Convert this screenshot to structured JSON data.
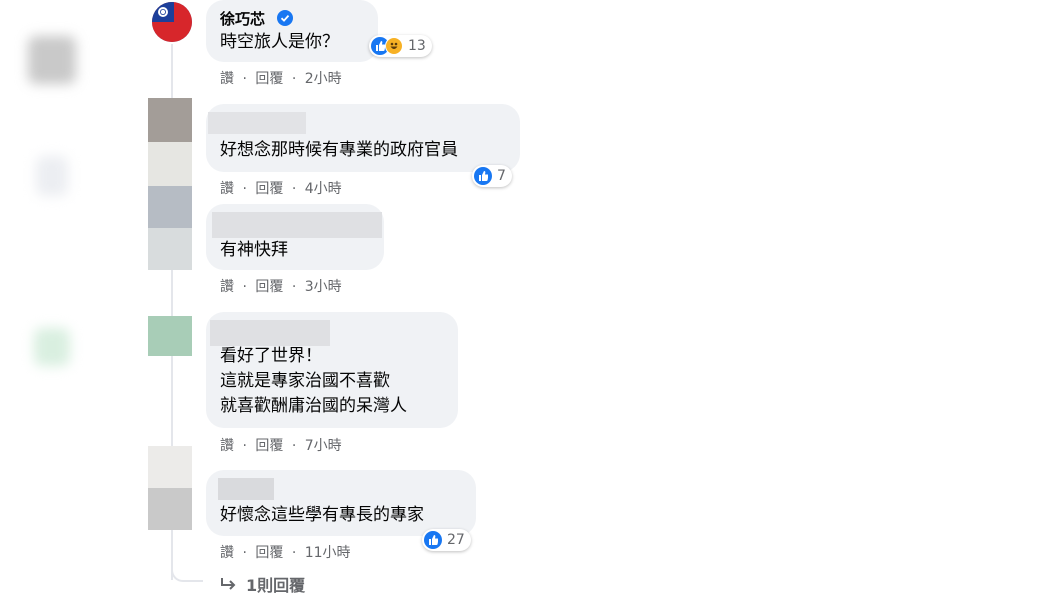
{
  "comments": [
    {
      "name": "徐巧芯",
      "text": "時空旅人是你？",
      "actions": [
        "讚",
        "回覆"
      ],
      "time": "2小時",
      "reactions": "13",
      "verified": true
    },
    {
      "name": "",
      "text": "好想念那時候有專業的政府官員",
      "actions": [
        "讚",
        "回覆"
      ],
      "time": "4小時",
      "reactions": "7"
    },
    {
      "name": "",
      "text": "有神快拜",
      "actions": [
        "讚",
        "回覆"
      ],
      "time": "3小時"
    },
    {
      "name": "",
      "text": "看好了世界！\n這就是專家治國不喜歡\n就喜歡酬庸治國的呆灣人",
      "actions": [
        "讚",
        "回覆"
      ],
      "time": "7小時"
    },
    {
      "name": "",
      "text": "好懷念這些學有專長的專家",
      "actions": [
        "讚",
        "回覆"
      ],
      "time": "11小時",
      "reactions": "27"
    }
  ],
  "replies_link": "1則回覆",
  "separator": "·",
  "colors": {
    "like_blue": "#1877f2",
    "haha_yellow": "#f7b125",
    "bubble_bg": "#f0f2f5",
    "meta_gray": "#65676b"
  }
}
